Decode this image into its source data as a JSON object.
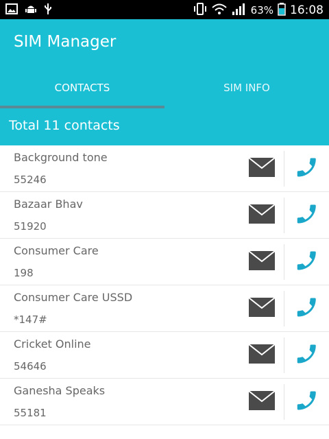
{
  "status_bar": {
    "battery": "63%",
    "time": "16:08"
  },
  "app": {
    "title": "SIM Manager"
  },
  "tabs": [
    {
      "label": "CONTACTS"
    },
    {
      "label": "SIM INFO"
    }
  ],
  "summary": {
    "text": "Total 11 contacts"
  },
  "contacts": [
    {
      "name": "Background tone",
      "number": "55246"
    },
    {
      "name": "Bazaar Bhav",
      "number": "51920"
    },
    {
      "name": "Consumer Care",
      "number": "198"
    },
    {
      "name": "Consumer Care USSD",
      "number": "*147#"
    },
    {
      "name": "Cricket Online",
      "number": "54646"
    },
    {
      "name": "Ganesha Speaks",
      "number": "55181"
    }
  ],
  "colors": {
    "accent": "#1bbfd4",
    "call_icon": "#1aa7c9",
    "message_icon": "#4a4a4a"
  },
  "icons": {
    "message": "envelope-icon",
    "call": "phone-icon"
  }
}
